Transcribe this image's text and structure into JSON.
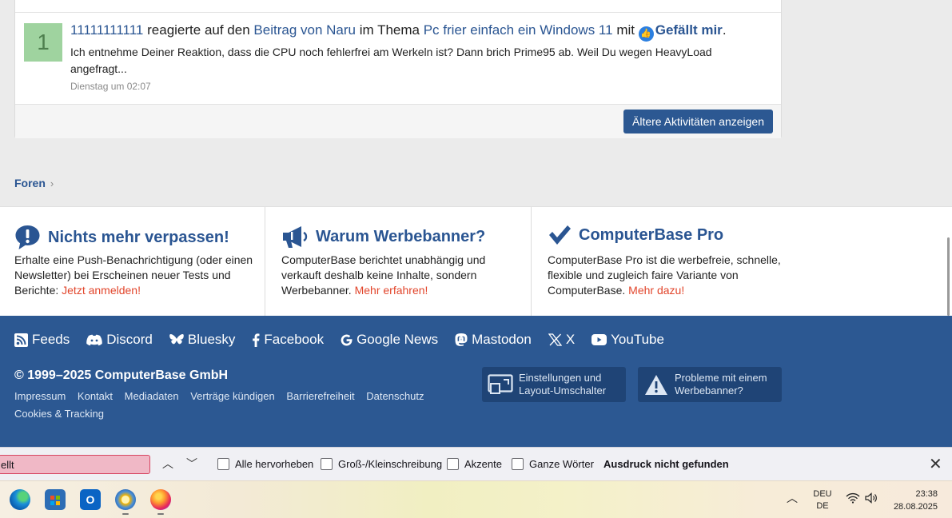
{
  "activity": {
    "user": "11111111111",
    "action_text": "reagierte auf den",
    "post_link": "Beitrag von Naru",
    "thread_prefix": "im Thema",
    "thread_link": "Pc frier einfach ein Windows 11",
    "with_text": "mit",
    "reaction": "Gefällt mir",
    "period": ".",
    "avatar_letter": "1",
    "excerpt": "Ich entnehme Deiner Reaktion, dass die CPU noch fehlerfrei am Werkeln ist? Dann brich Prime95 ab. Weil Du wegen HeavyLoad angefragt...",
    "time": "Dienstag um 02:07",
    "older_button": "Ältere Aktivitäten anzeigen"
  },
  "breadcrumb": {
    "label": "Foren",
    "chevron": "›"
  },
  "info": [
    {
      "title": "Nichts mehr verpassen!",
      "text": "Erhalte eine Push-Benachrichtigung (oder einen Newsletter) bei Erscheinen neuer Tests und Berichte: ",
      "link": "Jetzt anmelden!",
      "icon": "exclamation-bubble-icon"
    },
    {
      "title": "Warum Werbebanner?",
      "text": "ComputerBase berichtet unabhängig und verkauft deshalb keine Inhalte, sondern Werbebanner. ",
      "link": "Mehr erfahren!",
      "icon": "megaphone-icon"
    },
    {
      "title": "ComputerBase Pro",
      "text": "ComputerBase Pro ist die werbefreie, schnelle, flexible und zugleich faire Variante von ComputerBase. ",
      "link": "Mehr dazu!",
      "icon": "checkmark-icon"
    }
  ],
  "social": [
    "Feeds",
    "Discord",
    "Bluesky",
    "Facebook",
    "Google News",
    "Mastodon",
    "X",
    "YouTube"
  ],
  "copyright": "© 1999–2025 ComputerBase GmbH",
  "footer_links": [
    "Impressum",
    "Kontakt",
    "Mediadaten",
    "Verträge kündigen",
    "Barrierefreiheit",
    "Datenschutz",
    "Cookies & Tracking"
  ],
  "footer_buttons": {
    "settings_line1": "Einstellungen und",
    "settings_line2": "Layout-Umschalter",
    "problems_line1": "Probleme mit einem",
    "problems_line2": "Werbebanner?"
  },
  "findbar": {
    "query": "ellt",
    "highlight_all": "Alle hervorheben",
    "match_case": "Groß-/Kleinschreibung",
    "accents": "Akzente",
    "whole_words": "Ganze Wörter",
    "status": "Ausdruck nicht gefunden"
  },
  "taskbar": {
    "lang_top": "DEU",
    "lang_bottom": "DE",
    "time": "23:38",
    "date": "28.08.2025"
  }
}
